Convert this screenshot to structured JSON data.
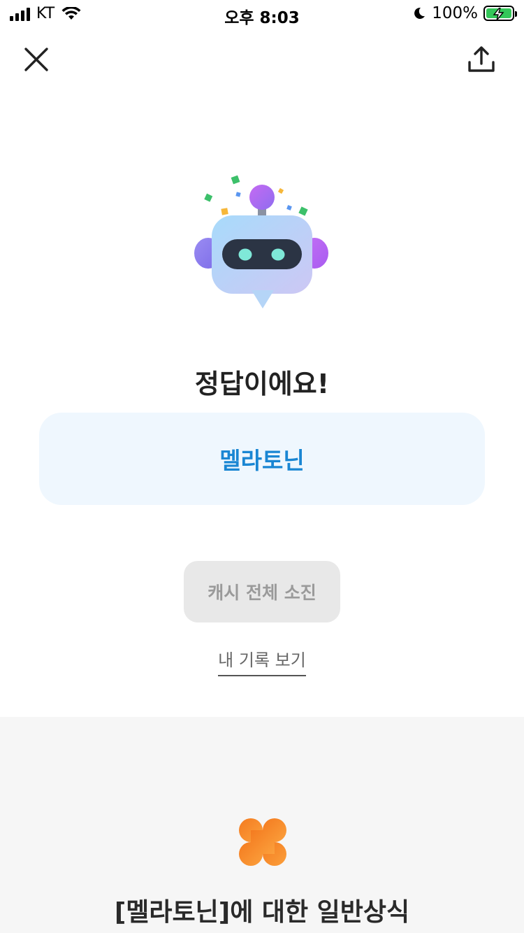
{
  "status_bar": {
    "carrier": "KT",
    "time": "오후 8:03",
    "battery": "100%"
  },
  "icons": {
    "close": "close-icon",
    "share": "share-upload-icon",
    "robot": "robot-illustration",
    "clover": "clover-icon"
  },
  "result": {
    "title": "정답이에요!",
    "answer": "멜라토닌"
  },
  "actions": {
    "cash_button": "캐시 전체 소진",
    "history_link": "내 기록 보기"
  },
  "info": {
    "title": "[멜라토닌]에 대한 일반상식"
  },
  "colors": {
    "answer_text": "#1a86d3",
    "answer_bg": "#eff7fe",
    "clover": "#f5892a",
    "battery": "#34c759"
  }
}
